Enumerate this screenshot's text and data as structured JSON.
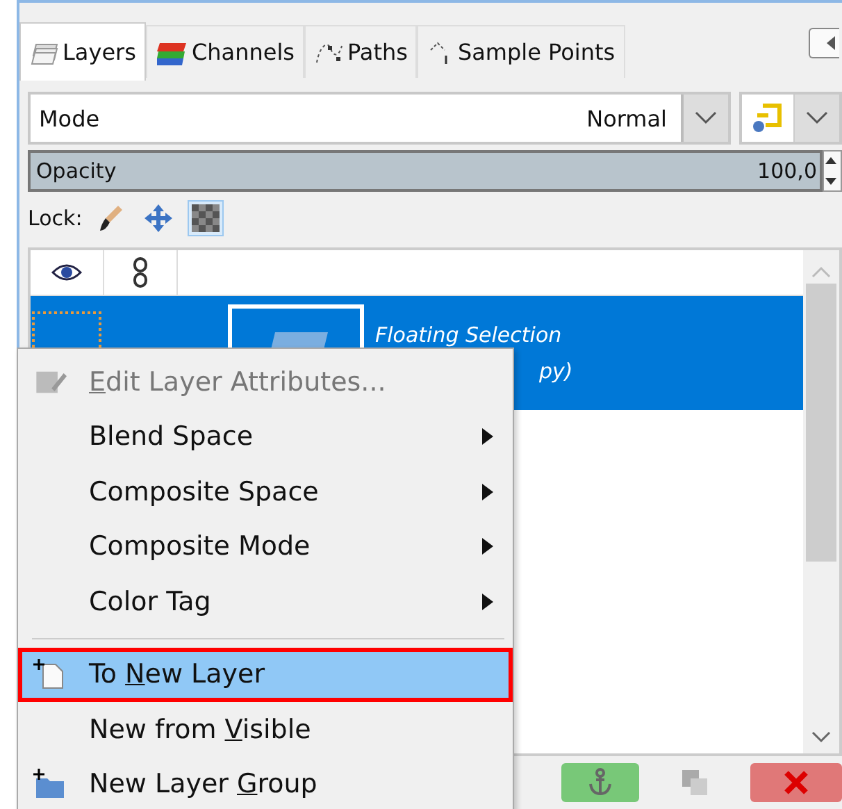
{
  "tabs": [
    {
      "label": "Layers",
      "selected": true
    },
    {
      "label": "Channels",
      "selected": false
    },
    {
      "label": "Paths",
      "selected": false
    },
    {
      "label": "Sample Points",
      "selected": false
    }
  ],
  "mode": {
    "label": "Mode",
    "value": "Normal"
  },
  "opacity": {
    "label": "Opacity",
    "value": "100,0",
    "level": 1
  },
  "lock": {
    "label": "Lock:",
    "items": [
      {
        "kind": "pixels",
        "on": false
      },
      {
        "kind": "position",
        "on": false
      },
      {
        "kind": "alpha",
        "on": true
      }
    ]
  },
  "layers": [
    {
      "name": "Floating Selection",
      "name_tail": "py)",
      "selected": true
    }
  ],
  "context_menu": [
    {
      "kind": "attributes",
      "key": "E",
      "post": "dit Layer Attributes...",
      "disabled": true,
      "selected": false
    },
    {
      "kind": "submenu",
      "pre": "Blend Space",
      "disabled": false,
      "selected": false
    },
    {
      "kind": "submenu",
      "pre": "Composite Space",
      "disabled": false,
      "selected": false
    },
    {
      "kind": "submenu",
      "pre": "Composite Mode",
      "disabled": false,
      "selected": false
    },
    {
      "kind": "submenu",
      "pre": "Color Tag",
      "disabled": false,
      "selected": false
    },
    {
      "kind": "separator"
    },
    {
      "kind": "new-layer",
      "pre": "To ",
      "key": "N",
      "post": "ew Layer",
      "disabled": false,
      "selected": true
    },
    {
      "kind": "command",
      "pre": "New from ",
      "key": "V",
      "post": "isible",
      "disabled": false,
      "selected": false
    },
    {
      "kind": "new-group",
      "pre": "New Layer ",
      "key": "G",
      "post": "roup",
      "disabled": false,
      "selected": false
    }
  ],
  "bottom_buttons": [
    {
      "kind": "anchor"
    },
    {
      "kind": "merge"
    },
    {
      "kind": "delete"
    }
  ]
}
